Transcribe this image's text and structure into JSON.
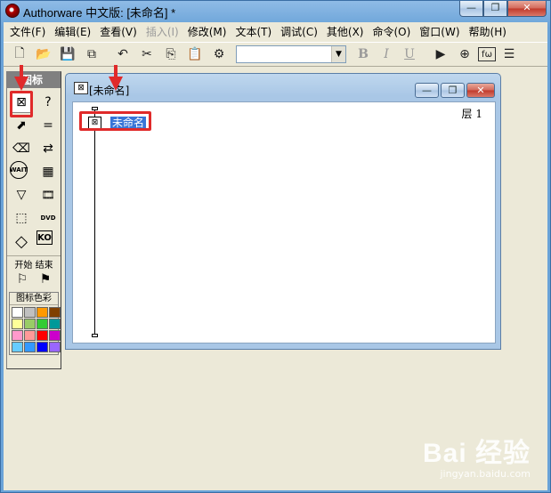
{
  "window": {
    "title": "Authorware 中文版: [未命名] *",
    "min_glyph": "—",
    "max_glyph": "❐",
    "close_glyph": "✕"
  },
  "menubar": {
    "items": [
      {
        "label": "文件(F)",
        "disabled": false
      },
      {
        "label": "编辑(E)",
        "disabled": false
      },
      {
        "label": "查看(V)",
        "disabled": false
      },
      {
        "label": "插入(I)",
        "disabled": true
      },
      {
        "label": "修改(M)",
        "disabled": false
      },
      {
        "label": "文本(T)",
        "disabled": false
      },
      {
        "label": "调试(C)",
        "disabled": false
      },
      {
        "label": "其他(X)",
        "disabled": false
      },
      {
        "label": "命令(O)",
        "disabled": false
      },
      {
        "label": "窗口(W)",
        "disabled": false
      },
      {
        "label": "帮助(H)",
        "disabled": false
      }
    ]
  },
  "toolbar": {
    "buttons": [
      {
        "icon": "new-file-icon",
        "glyph": "🗋"
      },
      {
        "icon": "open-folder-icon",
        "glyph": "📂"
      },
      {
        "icon": "save-all-icon",
        "glyph": "💾"
      },
      {
        "icon": "import-icon",
        "glyph": "⧉"
      },
      {
        "icon": "undo-icon",
        "glyph": "↶"
      },
      {
        "icon": "cut-icon",
        "glyph": "✂"
      },
      {
        "icon": "copy-icon",
        "glyph": "⎘"
      },
      {
        "icon": "paste-icon",
        "glyph": "📋"
      },
      {
        "icon": "find-icon",
        "glyph": "⚙"
      }
    ],
    "font_combo_value": "",
    "format_buttons": [
      {
        "icon": "bold-icon",
        "glyph": "B"
      },
      {
        "icon": "italic-icon",
        "glyph": "I"
      },
      {
        "icon": "underline-icon",
        "glyph": "U"
      }
    ],
    "right_buttons": [
      {
        "icon": "run-icon",
        "glyph": "▶"
      },
      {
        "icon": "control-panel-icon",
        "glyph": "⊕"
      },
      {
        "icon": "functions-icon",
        "glyph": "fω"
      },
      {
        "icon": "variables-icon",
        "glyph": "☰"
      }
    ]
  },
  "palette": {
    "title": "图标",
    "icons": [
      {
        "name": "display-icon",
        "glyph": "⊠"
      },
      {
        "name": "interaction-icon",
        "glyph": "?"
      },
      {
        "name": "motion-icon",
        "glyph": "⬈"
      },
      {
        "name": "calculation-icon",
        "glyph": "="
      },
      {
        "name": "erase-icon",
        "glyph": "⌫"
      },
      {
        "name": "navigate-icon",
        "glyph": "⇄"
      },
      {
        "name": "wait-icon",
        "glyph": "WAIT"
      },
      {
        "name": "framework-icon",
        "glyph": "▦"
      },
      {
        "name": "decision-icon",
        "glyph": "▽"
      },
      {
        "name": "digital-movie-icon",
        "glyph": "🎞"
      },
      {
        "name": "map-icon",
        "glyph": "⬚"
      },
      {
        "name": "dvd-icon",
        "glyph": "DVD"
      },
      {
        "name": "sound-icon",
        "glyph": "◇"
      },
      {
        "name": "knowledge-object-icon",
        "glyph": "KO"
      }
    ],
    "flags_label": "开始  结束",
    "start_flag_glyph": "⚐",
    "stop_flag_glyph": "⚑",
    "colors_label": "图标色彩",
    "swatches": [
      "#ffffff",
      "#c0c0c0",
      "#ff9900",
      "#804000",
      "#ffff99",
      "#99cc66",
      "#33cc33",
      "#009999",
      "#ff99cc",
      "#ff9999",
      "#ff0000",
      "#cc00cc",
      "#66ccff",
      "#3399ff",
      "#0000ff",
      "#9966ff"
    ]
  },
  "design_window": {
    "title": "[未命名]",
    "icon_glyph": "⊠",
    "level_label": "层 1",
    "node_glyph": "⊠",
    "node_label": "未命名"
  },
  "watermark": {
    "main": "Bai 经验",
    "sub": "jingyan.baidu.com"
  },
  "annotation_color": "#e02a2a"
}
